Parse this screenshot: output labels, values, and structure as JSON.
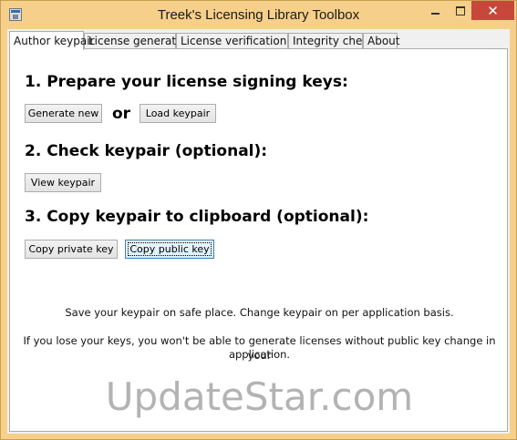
{
  "window": {
    "title": "Treek's Licensing Library Toolbox",
    "minimize_label": "",
    "close_label": "✕"
  },
  "tabs": [
    {
      "label": "Author keypair"
    },
    {
      "label": "License generation"
    },
    {
      "label": "License verification test"
    },
    {
      "label": "Integrity check"
    },
    {
      "label": "About"
    }
  ],
  "section1": {
    "heading": "1. Prepare your license signing keys:",
    "generate_label": "Generate new",
    "or_label": "or",
    "load_label": "Load keypair"
  },
  "section2": {
    "heading": "2. Check keypair (optional):",
    "view_label": "View keypair"
  },
  "section3": {
    "heading": "3. Copy keypair to clipboard (optional):",
    "copy_private_label": "Copy private key",
    "copy_public_label": "Copy public key"
  },
  "info": {
    "line1": "Save your keypair on safe place. Change keypair on per application basis.",
    "line2a": "If you lose your keys, you won't be able to generate licenses without public key change in your",
    "line2b": "application."
  },
  "watermark": "UpdateStar.com",
  "colors": {
    "titlebar": "#f6d08a",
    "close_button": "#c7473a",
    "tab_active": "#ffffff"
  }
}
